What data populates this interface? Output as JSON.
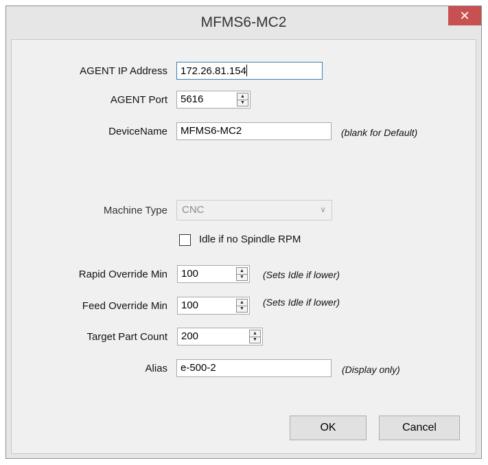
{
  "window": {
    "title": "MFMS6-MC2",
    "close_glyph": "✕",
    "colors": {
      "close_button": "#c75050",
      "focus_border": "#3c7fb1"
    }
  },
  "form": {
    "agent_ip": {
      "label": "AGENT IP Address",
      "value": "172.26.81.154"
    },
    "agent_port": {
      "label": "AGENT Port",
      "value": "5616"
    },
    "device_name": {
      "label": "DeviceName",
      "value": "MFMS6-MC2",
      "hint": "(blank for Default)"
    },
    "machine_type": {
      "label": "Machine Type",
      "value": "CNC",
      "enabled": false
    },
    "idle_no_spindle": {
      "label": "Idle if no Spindle RPM",
      "checked": false
    },
    "rapid_override_min": {
      "label": "Rapid Override Min",
      "value": "100",
      "hint": "(Sets Idle if lower)"
    },
    "feed_override_min": {
      "label": "Feed Override Min",
      "value": "100",
      "hint": "(Sets Idle if lower)"
    },
    "target_part_count": {
      "label": "Target Part Count",
      "value": "200"
    },
    "alias": {
      "label": "Alias",
      "value": "e-500-2",
      "hint": "(Display only)"
    }
  },
  "buttons": {
    "ok": "OK",
    "cancel": "Cancel"
  }
}
